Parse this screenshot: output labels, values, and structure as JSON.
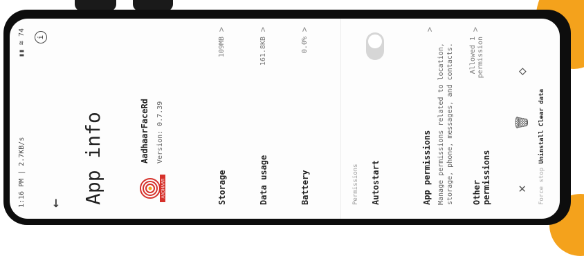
{
  "status_bar": {
    "time": "1:16 PM | 2.7KB/s",
    "icons": "▮▮ ≋ 74"
  },
  "header": {
    "title": "App info",
    "back_icon": "←",
    "info_icon": "i"
  },
  "app": {
    "name": "AadhaarFaceRd",
    "version": "Version: 0.7.39",
    "logo_text": "AADHAAR"
  },
  "rows": {
    "storage": {
      "label": "Storage",
      "value": "109MB"
    },
    "data_usage": {
      "label": "Data usage",
      "value": "161.8KB"
    },
    "battery": {
      "label": "Battery",
      "value": "0.0%"
    }
  },
  "permissions": {
    "section_label": "Permissions",
    "autostart": "Autostart",
    "app_permissions": "App permissions",
    "app_permissions_desc": "Manage permissions related to location, storage, phone, messages, and contacts.",
    "other_label": "Other permissions",
    "other_value": "Allowed 1 permission"
  },
  "bottom_bar": {
    "force_stop_icon": "✕",
    "uninstall_icon": "🗑",
    "clear_icon": "◇",
    "labels": {
      "force_stop": "Force stop",
      "uninstall": "Uninstall",
      "clear_data": "Clear data"
    }
  },
  "colors": {
    "accent": "#f4a21c",
    "toggle_off": "#d6d6d6"
  }
}
